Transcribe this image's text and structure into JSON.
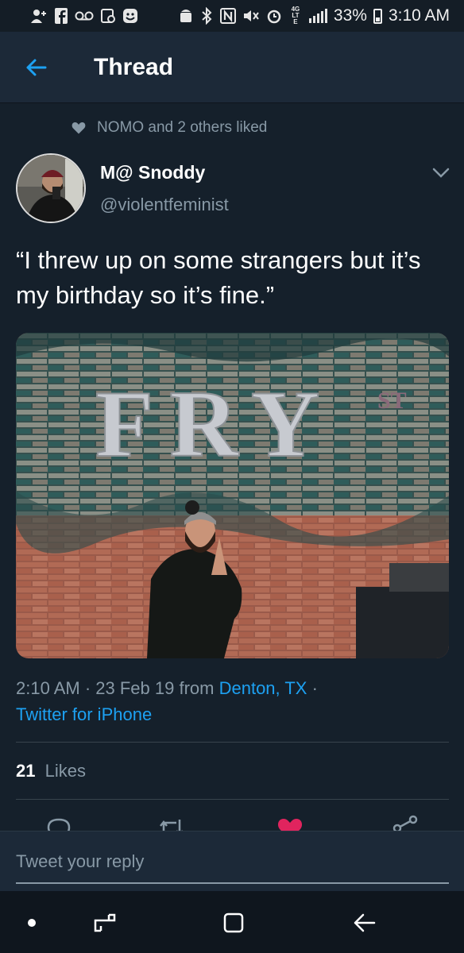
{
  "status_bar": {
    "icons": [
      "add-person-icon",
      "facebook-icon",
      "voicemail-icon",
      "screenshot-icon",
      "emoji-icon",
      "android-icon",
      "bluetooth-icon",
      "nfc-icon",
      "mute-icon",
      "alarm-icon",
      "data-icon",
      "signal-icon"
    ],
    "network_label": "4G LTE",
    "battery": "33%",
    "battery_fill_fraction": 0.33,
    "time": "3:10 AM"
  },
  "header": {
    "title": "Thread",
    "back_icon": "arrow-left-icon"
  },
  "tweet": {
    "social_context": "NOMO and 2 others liked",
    "social_icon": "heart-icon",
    "author": {
      "name": "M@ Snoddy",
      "handle": "@violentfeminist"
    },
    "text": "“I threw up on some strangers but it’s my birthday so it’s fine.”",
    "media_sign_letters": "FRY",
    "media_sign_suffix": "ST",
    "timestamp": "2:10 AM · 23 Feb 19 from",
    "location": "Denton, TX",
    "separator": "·",
    "client": "Twitter for iPhone",
    "likes_count": "21",
    "likes_label": "Likes",
    "actions": [
      "reply-icon",
      "retweet-icon",
      "like-icon",
      "share-icon"
    ]
  },
  "reply": {
    "placeholder": "Tweet your reply"
  },
  "nav": [
    "dot-button",
    "recents-button",
    "home-button",
    "back-button"
  ],
  "colors": {
    "background": "#15202b",
    "header": "#1c2938",
    "accent": "#1da1f2",
    "muted": "#8899a6",
    "like": "#e0245e"
  }
}
